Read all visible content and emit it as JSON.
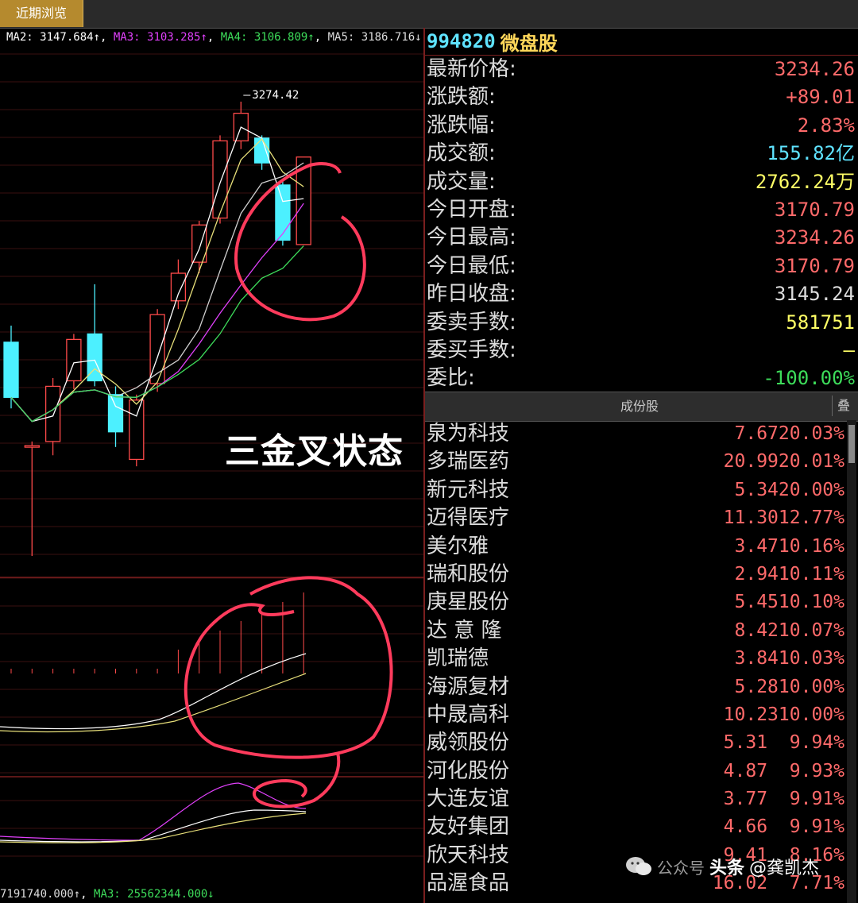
{
  "tab": {
    "label": "近期浏览"
  },
  "ma_line": {
    "ma2": "MA2: 3147.684↑",
    "ma3": "MA3: 3103.285↑",
    "ma4": "MA4: 3106.809↑",
    "ma5": "MA5: 3186.716↓",
    "colors": {
      "ma2": "#ffffff",
      "ma3": "#e040fb",
      "ma4": "#3ddc5a",
      "ma5": "#dcdcdc"
    }
  },
  "chart": {
    "peak_label": "3274.42",
    "overlay_text": "三金叉状态",
    "candles": [
      {
        "o": 3100,
        "c": 3060,
        "h": 3112,
        "l": 3052
      },
      {
        "o": 3025,
        "c": 3025,
        "h": 3028,
        "l": 2945
      },
      {
        "o": 3028,
        "c": 3068,
        "h": 3074,
        "l": 3018
      },
      {
        "o": 3072,
        "c": 3102,
        "h": 3106,
        "l": 3066
      },
      {
        "o": 3106,
        "c": 3072,
        "h": 3142,
        "l": 3068
      },
      {
        "o": 3062,
        "c": 3035,
        "h": 3068,
        "l": 3024
      },
      {
        "o": 3015,
        "c": 3058,
        "h": 3062,
        "l": 3010
      },
      {
        "o": 3070,
        "c": 3120,
        "h": 3124,
        "l": 3064
      },
      {
        "o": 3130,
        "c": 3150,
        "h": 3160,
        "l": 3124
      },
      {
        "o": 3158,
        "c": 3185,
        "h": 3188,
        "l": 3150
      },
      {
        "o": 3190,
        "c": 3246,
        "h": 3250,
        "l": 3186
      },
      {
        "o": 3246,
        "c": 3266,
        "h": 3274.42,
        "l": 3240
      },
      {
        "o": 3248,
        "c": 3230,
        "h": 3250,
        "l": 3225
      },
      {
        "o": 3214,
        "c": 3174,
        "h": 3218,
        "l": 3170
      },
      {
        "o": 3170.79,
        "c": 3234.26,
        "h": 3234.26,
        "l": 3170.79
      }
    ]
  },
  "header": {
    "code": "994820",
    "name": "微盘股"
  },
  "quote": [
    {
      "label": "最新价格:",
      "value": "3234.26",
      "color": "#ff6a6a"
    },
    {
      "label": "涨跌额:",
      "value": "+89.01",
      "color": "#ff6a6a"
    },
    {
      "label": "涨跌幅:",
      "value": "2.83%",
      "color": "#ff6a6a"
    },
    {
      "label": "成交额:",
      "value": "155.82亿",
      "color": "#5fe3ff"
    },
    {
      "label": "成交量:",
      "value": "2762.24万",
      "color": "#ffff66"
    },
    {
      "label": "今日开盘:",
      "value": "3170.79",
      "color": "#ff6a6a"
    },
    {
      "label": "今日最高:",
      "value": "3234.26",
      "color": "#ff6a6a"
    },
    {
      "label": "今日最低:",
      "value": "3170.79",
      "color": "#ff6a6a"
    },
    {
      "label": "昨日收盘:",
      "value": "3145.24",
      "color": "#dcdcdc"
    },
    {
      "label": "委卖手数:",
      "value": "581751",
      "color": "#ffff66"
    },
    {
      "label": "委买手数:",
      "value": "—",
      "color": "#ffff66"
    },
    {
      "label": "委比:",
      "value": "-100.00%",
      "color": "#3ddc5a"
    }
  ],
  "components_header": {
    "title": "成份股",
    "button": "叠"
  },
  "components": [
    {
      "name": "泉为科技",
      "value": "7.6720.03%"
    },
    {
      "name": "多瑞医药",
      "value": "20.9920.01%"
    },
    {
      "name": "新元科技",
      "value": "5.3420.00%"
    },
    {
      "name": "迈得医疗",
      "value": "11.3012.77%"
    },
    {
      "name": "美尔雅",
      "value": "3.4710.16%"
    },
    {
      "name": "瑞和股份",
      "value": "2.9410.11%"
    },
    {
      "name": "庚星股份",
      "value": "5.4510.10%"
    },
    {
      "name": "达 意 隆",
      "value": "8.4210.07%"
    },
    {
      "name": "凯瑞德",
      "value": "3.8410.03%"
    },
    {
      "name": "海源复材",
      "value": "5.2810.00%"
    },
    {
      "name": "中晟高科",
      "value": "10.2310.00%"
    },
    {
      "name": "威领股份",
      "value": "5.31  9.94%"
    },
    {
      "name": "河化股份",
      "value": "4.87  9.93%"
    },
    {
      "name": "大连友谊",
      "value": "3.77  9.91%"
    },
    {
      "name": "友好集团",
      "value": "4.66  9.91%"
    },
    {
      "name": "欣天科技",
      "value": "9.41  8.16%"
    },
    {
      "name": "品渥食品",
      "value": "16.02  7.71%"
    }
  ],
  "bottom_line": {
    "left": "7191740.000↑",
    "ma3": "MA3: 25562344.000↓"
  },
  "watermark": {
    "platform": "头条",
    "author": "@龚凯杰",
    "faint": "公众号"
  }
}
